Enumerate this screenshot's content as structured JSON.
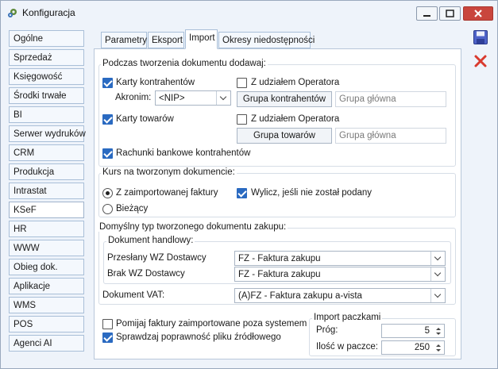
{
  "window": {
    "title": "Konfiguracja"
  },
  "sidebar": {
    "items": [
      "Ogólne",
      "Sprzedaż",
      "Księgowość",
      "Środki trwałe",
      "BI",
      "Serwer wydruków",
      "CRM",
      "Produkcja",
      "Intrastat",
      "KSeF",
      "HR",
      "WWW",
      "Obieg dok.",
      "Aplikacje",
      "WMS",
      "POS",
      "Agenci AI"
    ],
    "active": "KSeF"
  },
  "tabs": [
    "Parametry",
    "Eksport",
    "Import",
    "Okresy niedostępności"
  ],
  "active_tab": "Import",
  "group1": {
    "label": "Podczas tworzenia dokumentu dodawaj:",
    "karty_kontrahentow": "Karty kontrahentów",
    "akronim_label": "Akronim:",
    "akronim_value": "<NIP>",
    "z_udzialem_1": "Z udziałem Operatora",
    "grupa_kontrahentow": "Grupa kontrahentów",
    "grupa_glowna_1": "Grupa główna",
    "karty_towarow": "Karty towarów",
    "z_udzialem_2": "Z udziałem Operatora",
    "grupa_towarow": "Grupa towarów",
    "grupa_glowna_2": "Grupa główna",
    "rachunki": "Rachunki bankowe kontrahentów"
  },
  "group2": {
    "label": "Kurs na tworzonym dokumencie:",
    "radio1": "Z zaimportowanej faktury",
    "radio2": "Bieżący",
    "wylicz": "Wylicz, jeśli nie został podany"
  },
  "group3": {
    "label": "Domyślny typ tworzonego dokumentu zakupu:",
    "sub_label": "Dokument handlowy:",
    "przeslany_label": "Przesłany WZ Dostawcy",
    "przeslany_value": "FZ - Faktura zakupu",
    "brak_label": "Brak WZ Dostawcy",
    "brak_value": "FZ - Faktura zakupu",
    "vat_label": "Dokument VAT:",
    "vat_value": "(A)FZ - Faktura zakupu a-vista"
  },
  "bottom": {
    "pomijaj": "Pomijaj faktury zaimportowane poza systemem",
    "sprawdzaj": "Sprawdzaj poprawność pliku źródłowego"
  },
  "import_paczkami": {
    "label": "Import paczkami",
    "prog_label": "Próg:",
    "prog_value": "5",
    "ilosc_label": "Ilość w paczce:",
    "ilosc_value": "250"
  }
}
